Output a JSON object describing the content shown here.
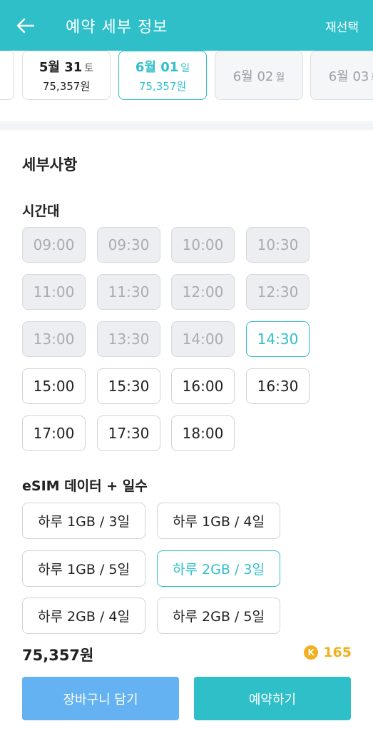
{
  "header": {
    "title": "예약 세부 정보",
    "reselect_label": "재선택"
  },
  "dates": [
    {
      "day": "",
      "dow": "",
      "price": "",
      "state": "normal"
    },
    {
      "day": "5월 31",
      "dow": "토",
      "price": "75,357원",
      "state": "normal"
    },
    {
      "day": "6월 01",
      "dow": "일",
      "price": "75,357원",
      "state": "selected"
    },
    {
      "day": "6월 02",
      "dow": "월",
      "price": "",
      "state": "disabled"
    },
    {
      "day": "6월 03",
      "dow": "화",
      "price": "",
      "state": "disabled"
    }
  ],
  "details": {
    "section_title": "세부사항",
    "time_title": "시간대",
    "plan_title": "eSIM 데이터 + 일수"
  },
  "time_slots": [
    {
      "label": "09:00",
      "state": "disabled"
    },
    {
      "label": "09:30",
      "state": "disabled"
    },
    {
      "label": "10:00",
      "state": "disabled"
    },
    {
      "label": "10:30",
      "state": "disabled"
    },
    {
      "label": "11:00",
      "state": "disabled"
    },
    {
      "label": "11:30",
      "state": "disabled"
    },
    {
      "label": "12:00",
      "state": "disabled"
    },
    {
      "label": "12:30",
      "state": "disabled"
    },
    {
      "label": "13:00",
      "state": "disabled"
    },
    {
      "label": "13:30",
      "state": "disabled"
    },
    {
      "label": "14:00",
      "state": "disabled"
    },
    {
      "label": "14:30",
      "state": "selected"
    },
    {
      "label": "15:00",
      "state": "available"
    },
    {
      "label": "15:30",
      "state": "available"
    },
    {
      "label": "16:00",
      "state": "available"
    },
    {
      "label": "16:30",
      "state": "available"
    },
    {
      "label": "17:00",
      "state": "available"
    },
    {
      "label": "17:30",
      "state": "available"
    },
    {
      "label": "18:00",
      "state": "available"
    }
  ],
  "plans": [
    {
      "label": "하루 1GB / 3일",
      "state": "available"
    },
    {
      "label": "하루 1GB / 4일",
      "state": "available"
    },
    {
      "label": "하루 1GB / 5일",
      "state": "available"
    },
    {
      "label": "하루 2GB / 3일",
      "state": "selected"
    },
    {
      "label": "하루 2GB / 4일",
      "state": "available"
    },
    {
      "label": "하루 2GB / 5일",
      "state": "available"
    }
  ],
  "summary": {
    "total_price": "75,357원",
    "points_icon": "K",
    "points": "165"
  },
  "actions": {
    "cart_label": "장바구니 담기",
    "book_label": "예약하기"
  },
  "colors": {
    "accent": "#2fbfc9",
    "cart_button": "#65b2f2",
    "points": "#f2b01e"
  }
}
